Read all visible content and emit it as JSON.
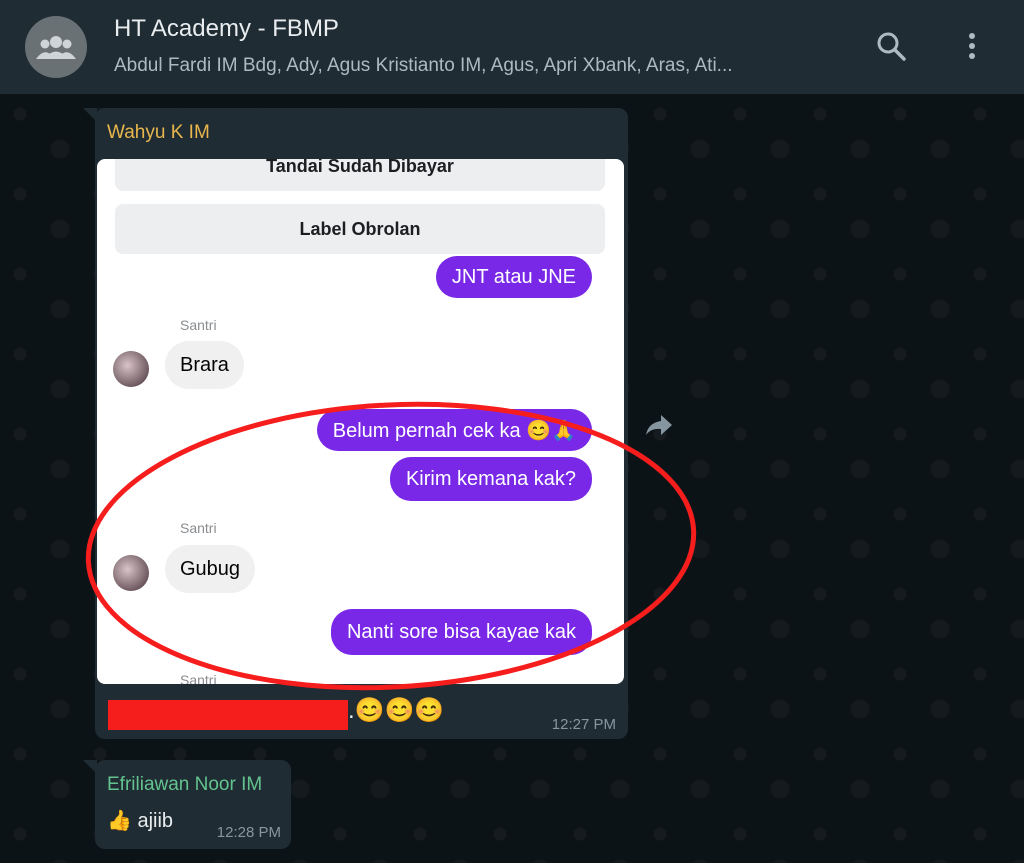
{
  "header": {
    "title": "HT Academy - FBMP",
    "members": "Abdul Fardi IM Bdg, Ady, Agus Kristianto IM, Agus, Apri Xbank, Aras, Ati...",
    "icons": [
      "group-avatar-icon",
      "search-icon",
      "more-options-icon"
    ]
  },
  "messages": [
    {
      "sender": "Wahyu K IM",
      "sender_color": "#e8b64c",
      "screenshot": {
        "buttons": [
          "Tandai Sudah Dibayar",
          "Label Obrolan"
        ],
        "chat": {
          "sent_1": "JNT atau JNE",
          "santri_1": "Santri",
          "recv_1": "Brara",
          "sent_2": "Belum pernah cek ka 😊🙏",
          "sent_3": "Kirim kemana kak?",
          "santri_2": "Santri",
          "recv_2": "Gubug",
          "sent_4": "Nanti sore bisa kayae kak",
          "santri_3": "Santri"
        },
        "sent_color": "#7a28e8",
        "highlight_color": "#f61d1d"
      },
      "caption_tail": ".😊😊😊",
      "time": "12:27 PM"
    },
    {
      "sender": "Efriliawan Noor IM",
      "sender_color": "#63c38f",
      "text": "👍 ajiib",
      "time": "12:28 PM"
    }
  ]
}
